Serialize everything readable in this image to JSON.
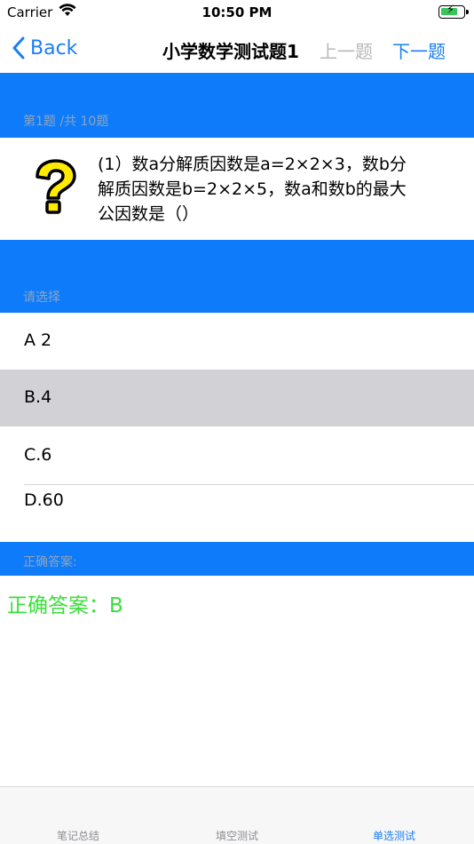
{
  "status_bar": {
    "carrier": "Carrier",
    "time": "10:50 PM"
  },
  "nav": {
    "back_label": "Back",
    "title": "小学数学测试题1",
    "prev_label": "上一题",
    "next_label": "下一题"
  },
  "progress": {
    "label": "第1题 /共 10题"
  },
  "question": {
    "line1": "(1）数a分解质因数是a=2×2×3，数b分",
    "line2": "解质因数是b=2×2×5，数a和数b的最大",
    "line3": "公因数是（）"
  },
  "choose": {
    "label": "请选择"
  },
  "options": [
    {
      "label": "A 2",
      "selected": false
    },
    {
      "label": "B.4",
      "selected": true
    },
    {
      "label": "C.6",
      "selected": false
    },
    {
      "label": "D.60",
      "selected": false
    }
  ],
  "answer": {
    "section_label": "正确答案:",
    "text": "正确答案：B",
    "color": "#3adf3a"
  },
  "tabs": [
    {
      "label": "笔记总结",
      "active": false
    },
    {
      "label": "填空测试",
      "active": false
    },
    {
      "label": "单选测试",
      "active": true
    }
  ],
  "colors": {
    "accent": "#1a7ef5",
    "band": "#0d7bfa",
    "selected_row": "#d1d1d6"
  },
  "icons": [
    "wifi-icon",
    "battery-icon",
    "chevron-left-icon",
    "question-mark-icon"
  ]
}
